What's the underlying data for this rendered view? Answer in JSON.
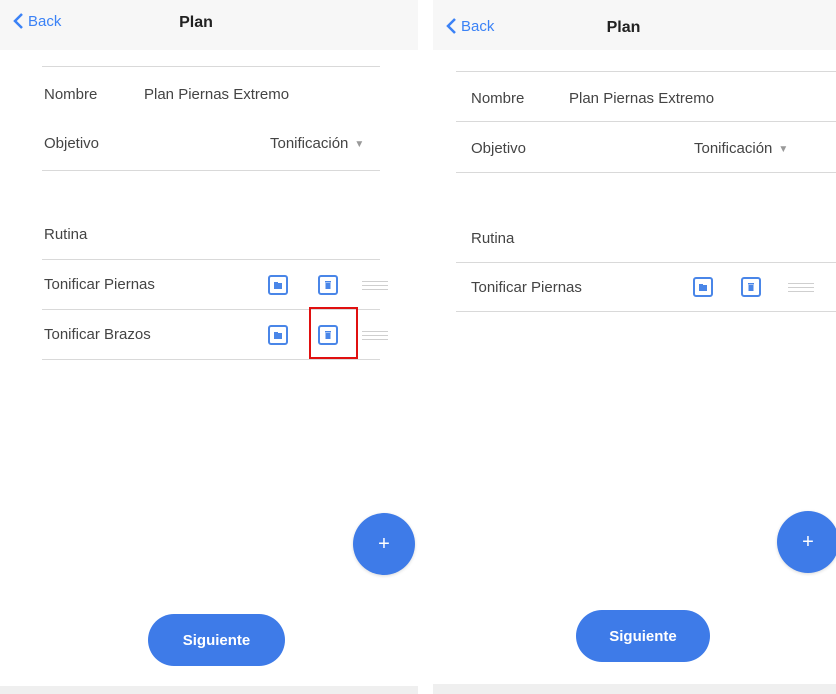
{
  "screens": [
    {
      "back_label": "Back",
      "title": "Plan",
      "nombre_label": "Nombre",
      "nombre_value": "Plan Piernas Extremo",
      "objetivo_label": "Objetivo",
      "objetivo_value": "Tonificación",
      "rutina_label": "Rutina",
      "routines": [
        "Tonificar Piernas",
        "Tonificar Brazos"
      ],
      "fab_label": "+",
      "next_label": "Siguiente"
    },
    {
      "back_label": "Back",
      "title": "Plan",
      "nombre_label": "Nombre",
      "nombre_value": "Plan Piernas Extremo",
      "objetivo_label": "Objetivo",
      "objetivo_value": "Tonificación",
      "rutina_label": "Rutina",
      "routines": [
        "Tonificar Piernas"
      ],
      "fab_label": "+",
      "next_label": "Siguiente"
    }
  ],
  "colors": {
    "accent": "#3e7be8",
    "highlight": "#e01010",
    "navbar_bg": "#f7f7f7",
    "divider": "#d9d9d9"
  },
  "icons": [
    "chevron-left-icon",
    "edit-icon",
    "trash-icon",
    "drag-handle-icon",
    "plus-icon"
  ]
}
